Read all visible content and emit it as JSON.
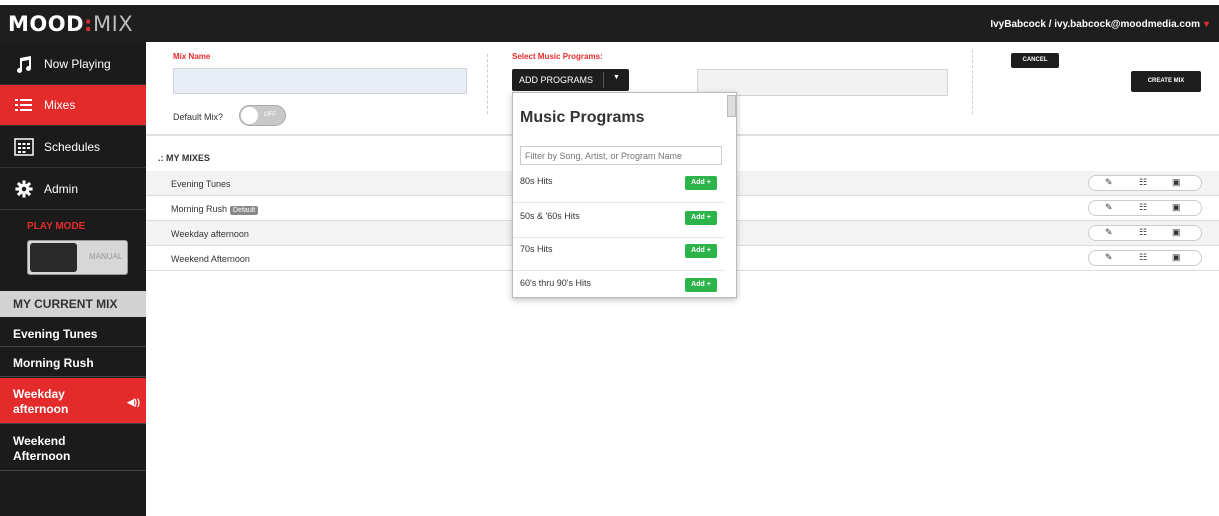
{
  "header": {
    "logo_mood": "MOOD",
    "logo_colon": ":",
    "logo_mix": "MIX",
    "user": "IvyBabcock / ivy.babcock@moodmedia.com"
  },
  "sidebar": {
    "items": [
      {
        "label": "Now Playing",
        "icon": "music-note-icon"
      },
      {
        "label": "Mixes",
        "icon": "list-icon"
      },
      {
        "label": "Schedules",
        "icon": "calendar-icon"
      },
      {
        "label": "Admin",
        "icon": "gear-icon"
      }
    ],
    "play_mode_label": "PLAY MODE",
    "manual_label": "MANUAL",
    "current_mix_heading": "MY CURRENT MIX",
    "current_mix_items": [
      "Evening Tunes",
      "Morning Rush",
      "Weekday afternoon",
      "Weekend Afternoon"
    ]
  },
  "form": {
    "mix_name_label": "Mix Name",
    "mix_name_value": "",
    "default_mix_label": "Default Mix?",
    "default_toggle_text": "OFF",
    "select_programs_label": "Select Music Programs:",
    "add_programs_label": "ADD PROGRAMS",
    "cancel_label": "CANCEL",
    "create_label": "CREATE MIX"
  },
  "my_mixes": {
    "heading": ".: MY MIXES",
    "rows": [
      {
        "name": "Evening Tunes",
        "badge": ""
      },
      {
        "name": "Morning Rush",
        "badge": "Default"
      },
      {
        "name": "Weekday afternoon",
        "badge": ""
      },
      {
        "name": "Weekend Afternoon",
        "badge": ""
      }
    ]
  },
  "dropdown": {
    "title": "Music Programs",
    "filter_placeholder": "Filter by Song, Artist, or Program Name",
    "add_label": "Add +",
    "programs": [
      "80s Hits",
      "50s & '60s Hits",
      "70s Hits",
      "60's thru 90's Hits"
    ]
  },
  "colors": {
    "accent_red": "#e32b2b",
    "dark": "#1e1e1e",
    "add_green": "#2cb34a"
  }
}
